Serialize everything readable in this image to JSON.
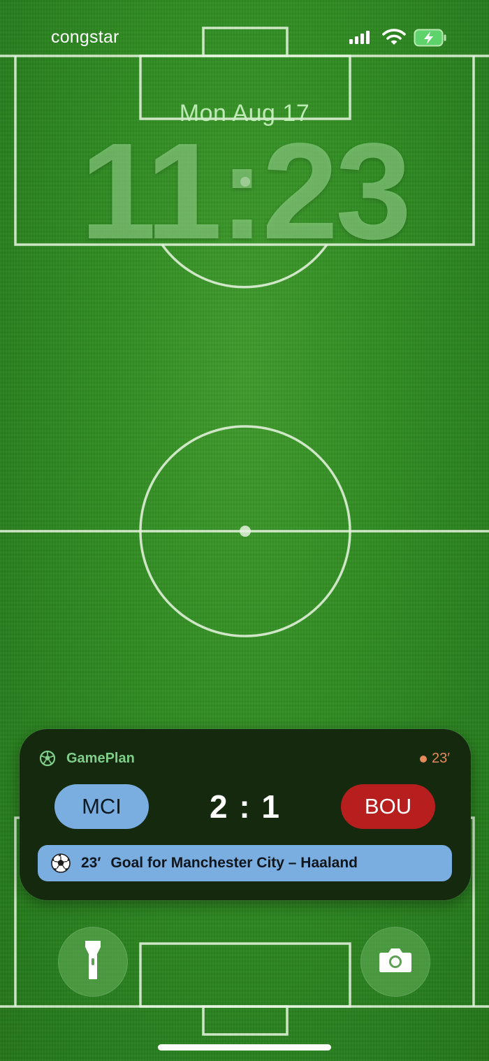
{
  "status_bar": {
    "carrier": "congstar",
    "icons": [
      "cellular-signal-icon",
      "wifi-icon",
      "battery-charging-icon"
    ]
  },
  "lock_screen": {
    "date": "Mon Aug 17",
    "time": "11:23",
    "wallpaper": "football-pitch"
  },
  "live_activity": {
    "app_icon": "soccer-ball-icon",
    "app_name": "GamePlan",
    "live_minute": "23′",
    "home_team": {
      "code": "MCI",
      "color": "#7aaee0"
    },
    "away_team": {
      "code": "BOU",
      "color": "#b71f1f"
    },
    "score": "2 : 1",
    "event": {
      "icon": "soccer-ball-icon",
      "minute": "23′",
      "text": "Goal for Manchester City – Haaland",
      "color": "#7aaee0"
    },
    "colors": {
      "background": "#15290f",
      "app_name": "#7fcf8a",
      "live": "#e58a5a"
    }
  },
  "quick_actions": {
    "left_icon": "flashlight-icon",
    "right_icon": "camera-icon"
  }
}
